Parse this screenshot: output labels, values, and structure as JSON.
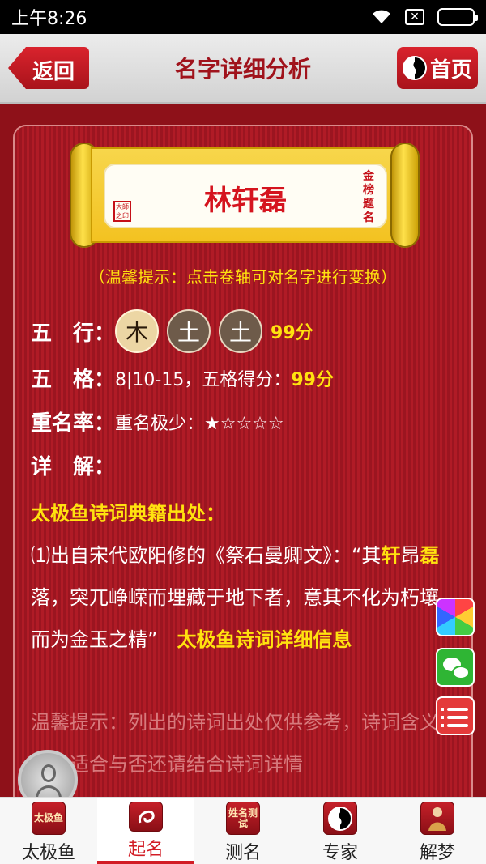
{
  "status": {
    "time": "上午8:26",
    "sim": "✕"
  },
  "header": {
    "back_label": "返回",
    "title": "名字详细分析",
    "home_label": "首页"
  },
  "scroll": {
    "name": "林轩磊",
    "seal": "大師之印",
    "vertical": "金榜题名"
  },
  "tip": "（温馨提示：点击卷轴可对名字进行变换）",
  "wuxing": {
    "label": "五　行：",
    "elements": [
      "木",
      "土",
      "土"
    ],
    "score": "99分"
  },
  "wuge": {
    "label": "五　格：",
    "value": "8|10-15，五格得分：",
    "score": "99分"
  },
  "chongming": {
    "label": "重名率：",
    "value": "重名极少：★☆☆☆☆"
  },
  "xiangjie": {
    "label": "详　解："
  },
  "poem": {
    "title": "太极鱼诗词典籍出处：",
    "p1": "⑴出自宋代欧阳修的《祭石曼卿文》：“其",
    "hl1": "轩",
    "p2": "昂",
    "hl2": "磊",
    "p3": "落，突兀峥嵘而埋藏于地下者，意其不化为朽壤，而为金玉之精”",
    "link": "太极鱼诗词详细信息"
  },
  "warm_tip": "温馨提示：列出的诗词出处仅供参考，诗词含义深远，适合与否还请结合诗词详情",
  "nav": [
    {
      "label": "太极鱼",
      "icon": "太极鱼"
    },
    {
      "label": "起名",
      "icon": ""
    },
    {
      "label": "测名",
      "icon": "姓名测试"
    },
    {
      "label": "专家",
      "icon": ""
    },
    {
      "label": "解梦",
      "icon": ""
    }
  ]
}
